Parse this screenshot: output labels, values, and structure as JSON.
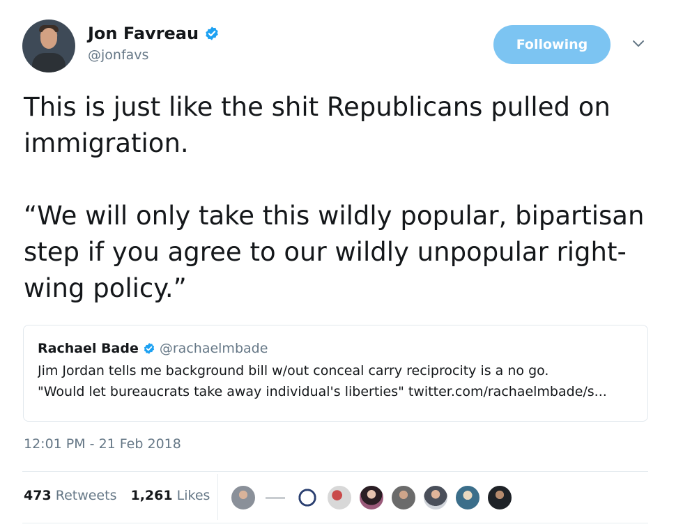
{
  "author": {
    "display_name": "Jon Favreau",
    "handle": "@jonfavs",
    "verified": true
  },
  "follow_button": {
    "label": "Following"
  },
  "tweet": {
    "text": "This is just like the shit Republicans pulled on immigration.\n\n“We will only take this wildly popular, bipartisan step if you agree to our wildly unpopular right-wing policy.”"
  },
  "quoted_tweet": {
    "display_name": "Rachael Bade",
    "handle": "@rachaelmbade",
    "verified": true,
    "text_line1": "Jim Jordan tells me background  bill w/out conceal carry reciprocity is a no go.",
    "text_line2": "\"Would let bureaucrats take away individual's liberties\" twitter.com/rachaelmbade/s..."
  },
  "timestamp": "12:01 PM - 21 Feb 2018",
  "stats": {
    "retweets_count": "473",
    "retweets_label": "Retweets",
    "likes_count": "1,261",
    "likes_label": "Likes"
  },
  "colors": {
    "accent": "#1da1f2",
    "follow_button_bg": "#7cc4f2",
    "secondary_text": "#657786",
    "border": "#e1e8ed"
  },
  "icons": {
    "verified": "verified-badge-icon",
    "caret": "chevron-down-icon"
  }
}
